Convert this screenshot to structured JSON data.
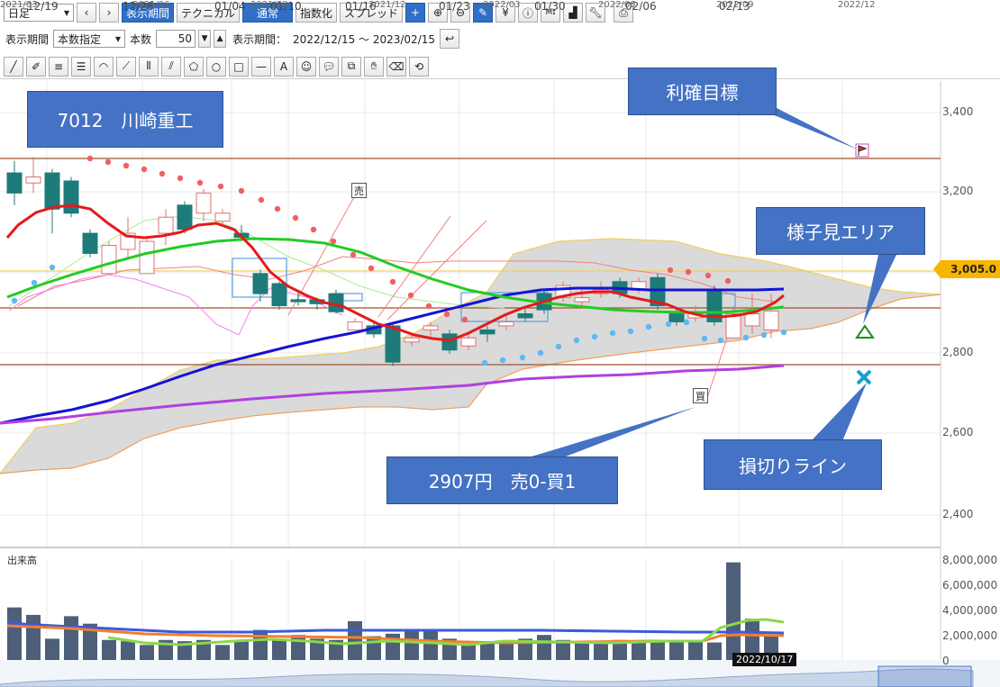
{
  "toolbar1": {
    "period_select": "日足",
    "period_button": "表示期間",
    "technical_button": "テクニカル",
    "normal_button": "通常",
    "index_button": "指数化",
    "spread_button": "スプレッド"
  },
  "toolbar2": {
    "display_period_label": "表示期間",
    "mode_select": "本数指定",
    "count_label": "本数",
    "count_value": "50",
    "range_label": "表示期間：",
    "range_value": "2022/12/15 ～ 2023/02/15"
  },
  "toolbar3": {
    "text_tool": "A"
  },
  "annotations": {
    "title": "7012　川崎重工",
    "target": "利確目標",
    "watch": "様子見エリア",
    "stoploss": "損切りライン",
    "signal": "2907円　売0-買1",
    "sell_mark": "売",
    "buy_mark": "買"
  },
  "price_axis": {
    "labels": [
      "3,400",
      "3,200",
      "3,000",
      "2,800",
      "2,600",
      "2,400"
    ],
    "current_price": "3,005.0"
  },
  "volume": {
    "title": "出来高",
    "labels": [
      "8,000,000",
      "6,000,000",
      "4,000,000",
      "2,000,000",
      "0"
    ],
    "values_m": [
      4.2,
      3.6,
      1.7,
      3.5,
      2.9,
      1.6,
      1.5,
      1.2,
      1.6,
      1.5,
      1.6,
      1.2,
      1.6,
      2.4,
      1.7,
      2.0,
      1.7,
      1.6,
      3.1,
      1.9,
      2.1,
      2.3,
      2.3,
      1.7,
      1.3,
      1.5,
      1.3,
      1.7,
      2.0,
      1.6,
      1.5,
      1.5,
      1.6,
      1.5,
      1.5,
      1.4,
      1.5,
      1.4,
      7.8,
      3.3,
      2.0
    ]
  },
  "dates": {
    "ticks": [
      "12/19",
      "12/26",
      "01/04",
      "01/10",
      "01/16",
      "01/23",
      "01/30",
      "02/06",
      "02/13"
    ],
    "crosshair_date": "2022/10/17"
  },
  "navigator": {
    "ticks": [
      "2021/03",
      "2021/06",
      "2021/09",
      "2021/12",
      "2022/03",
      "2022/06",
      "2022/09",
      "2022/12"
    ]
  },
  "colors": {
    "up_candle": "#e8a0a0",
    "down_candle": "#1f7a7a",
    "sma_short": "#e31a1c",
    "sma_mid": "#22cc22",
    "sma_long": "#1414d4",
    "sma_xlong": "#b040e0",
    "cloud": "#d6d6d6",
    "accent": "#4472c4"
  }
}
